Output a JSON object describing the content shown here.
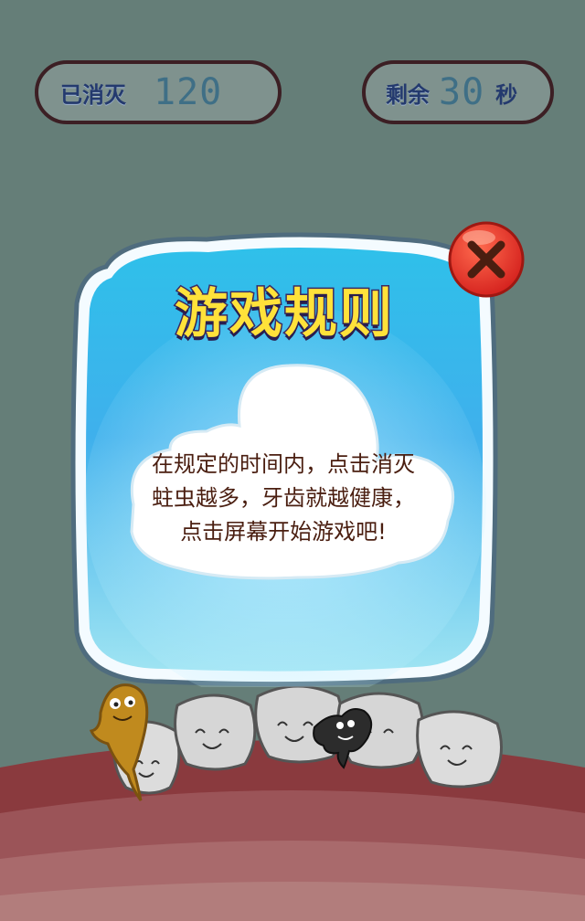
{
  "hud": {
    "killed_label": "已消灭",
    "killed_value": "120",
    "remaining_label": "剩余",
    "remaining_value": "30",
    "remaining_unit": "秒"
  },
  "dialog": {
    "title": "游戏规则",
    "body": "在规定的时间内，点击消灭蛀虫越多，牙齿就越健康，点击屏幕开始游戏吧!",
    "close_icon": "close-x-icon"
  },
  "colors": {
    "background": "#657e78",
    "panel": "#3fb8e6",
    "title": "#ffe23a",
    "close_button": "#e23a2e"
  }
}
